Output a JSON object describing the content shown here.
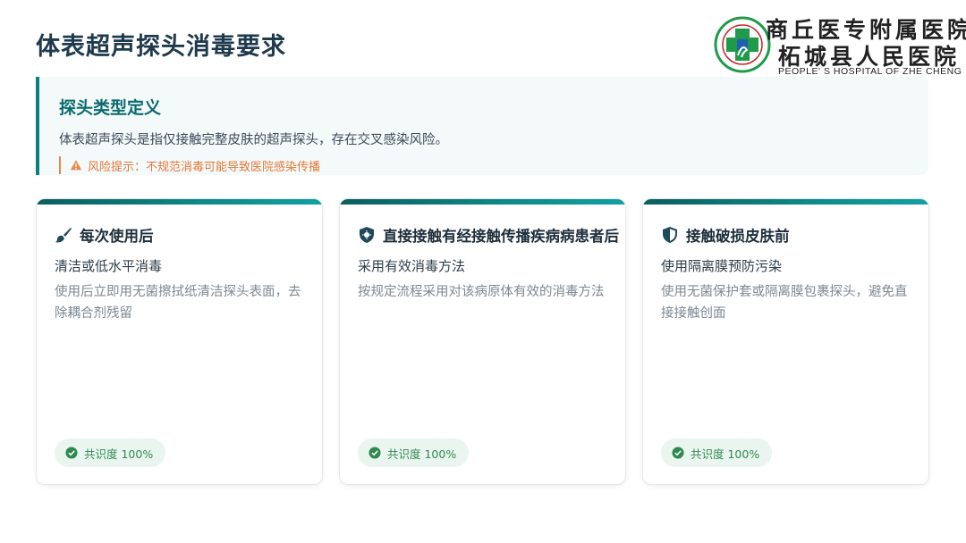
{
  "page": {
    "title": "体表超声探头消毒要求"
  },
  "logo": {
    "name_line1": "商丘医专附属医院",
    "name_line2": "柘城县人民医院",
    "name_en": "PEOPLE' S HOSPITAL OF ZHE CHENG",
    "emblem_icon": "hospital-emblem-icon",
    "colors": {
      "green": "#1f9a4a",
      "blue": "#1d5fb0",
      "red": "#c8262b"
    }
  },
  "definition": {
    "title": "探头类型定义",
    "text": "体表超声探头是指仅接触完整皮肤的超声探头，存在交叉感染风险。",
    "risk": "风险提示：不规范消毒可能导致医院感染传播",
    "risk_icon": "warning-icon"
  },
  "cards": [
    {
      "icon": "brush-icon",
      "title": "每次使用后",
      "subtitle": "清洁或低水平消毒",
      "desc": "使用后立即用无菌擦拭纸清洁探头表面，去除耦合剂残留",
      "badge": "共识度 100%"
    },
    {
      "icon": "shield-virus-icon",
      "title": "直接接触有经接触传播疾病病患者后",
      "subtitle": "采用有效消毒方法",
      "desc": "按规定流程采用对该病原体有效的消毒方法",
      "badge": "共识度 100%"
    },
    {
      "icon": "shield-icon",
      "title": "接触破损皮肤前",
      "subtitle": "使用隔离膜预防污染",
      "desc": "使用无菌保护套或隔离膜包裹探头，避免直接接触创面",
      "badge": "共识度 100%"
    }
  ],
  "colors": {
    "accent": "#0e7f80",
    "risk": "#e07a38",
    "badge_text": "#2f8a52"
  }
}
